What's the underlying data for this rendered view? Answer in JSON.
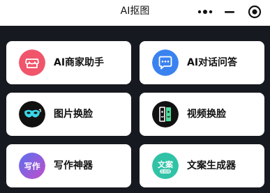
{
  "nav": {
    "title": "AI抠图"
  },
  "tools": [
    {
      "label": "AI商家助手",
      "icon": "storefront-icon",
      "color": "#f0556b"
    },
    {
      "label": "AI对话问答",
      "icon": "chat-bubble-icon",
      "color": "#3a82f0"
    },
    {
      "label": "图片换脸",
      "icon": "mask-icon",
      "color": "#111111"
    },
    {
      "label": "视频换脸",
      "icon": "face-swap-icon",
      "color": "#111111"
    },
    {
      "label": "写作神器",
      "icon": "writing-icon",
      "icon_text": "写作",
      "color": "#9b4fd6"
    },
    {
      "label": "文案生成器",
      "icon": "copywriting-icon",
      "icon_text": "文案",
      "icon_subtext": "生成器",
      "color": "#2fc2a6"
    }
  ]
}
